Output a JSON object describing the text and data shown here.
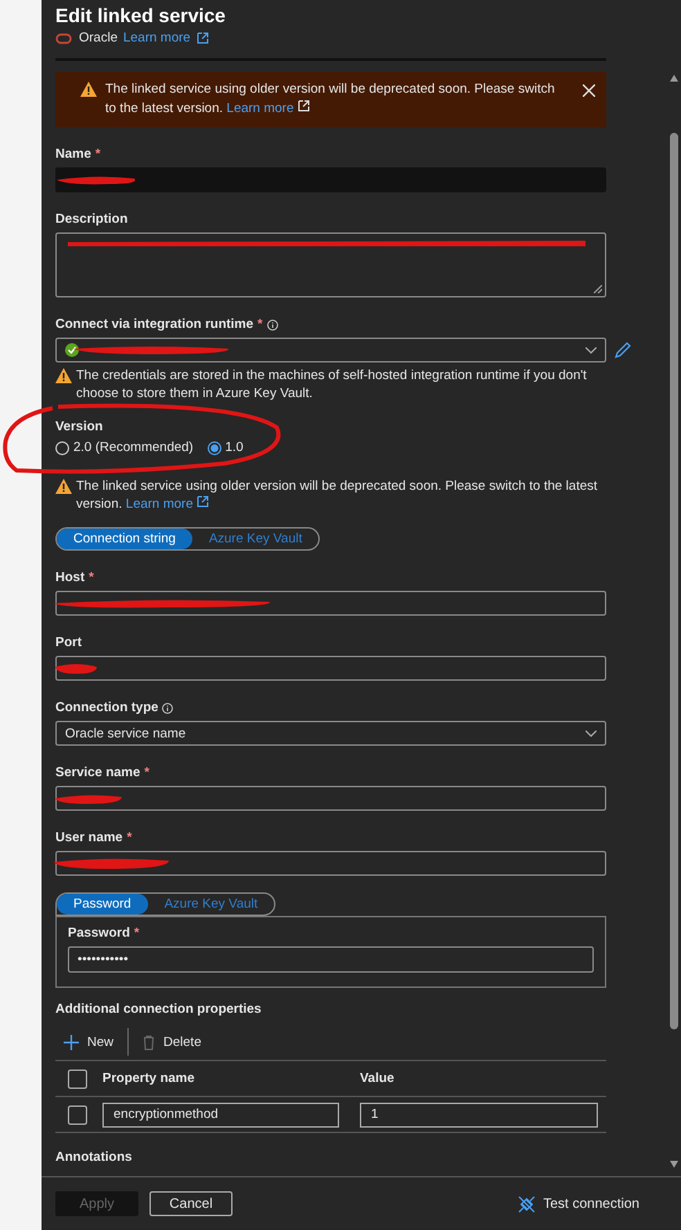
{
  "header": {
    "title": "Edit linked service",
    "service": "Oracle",
    "learn_more": "Learn more"
  },
  "banner": {
    "message": "The linked service using older version will be deprecated soon. Please switch to the latest version.",
    "link": "Learn more"
  },
  "name": {
    "label": "Name",
    "mark": "*"
  },
  "description": {
    "label": "Description"
  },
  "runtime": {
    "label": "Connect via integration runtime",
    "mark": "*",
    "warning": "The credentials are stored in the machines of self-hosted integration runtime if you don't choose to store them in Azure Key Vault."
  },
  "version": {
    "label": "Version",
    "options": [
      {
        "label": "2.0 (Recommended)",
        "selected": false
      },
      {
        "label": "1.0",
        "selected": true
      }
    ],
    "warning": "The linked service using older version will be deprecated soon. Please switch to the latest version.",
    "link": "Learn more"
  },
  "connection_tabs": [
    {
      "label": "Connection string",
      "selected": true
    },
    {
      "label": "Azure Key Vault",
      "selected": false
    }
  ],
  "host": {
    "label": "Host",
    "mark": "*"
  },
  "port": {
    "label": "Port"
  },
  "connection_type": {
    "label": "Connection type",
    "value": "Oracle service name"
  },
  "service_name": {
    "label": "Service name",
    "mark": "*"
  },
  "user_name": {
    "label": "User name",
    "mark": "*"
  },
  "password_tabs": [
    {
      "label": "Password",
      "selected": true
    },
    {
      "label": "Azure Key Vault",
      "selected": false
    }
  ],
  "password": {
    "label": "Password",
    "mark": "*",
    "value": "•••••••••••"
  },
  "additional": {
    "title": "Additional connection properties",
    "new": "New",
    "delete": "Delete",
    "columns": [
      "Property name",
      "Value"
    ],
    "rows": [
      {
        "checked": false,
        "property": "encryptionmethod",
        "value": "1"
      }
    ],
    "header_checked": false
  },
  "annotations": {
    "title": "Annotations"
  },
  "footer": {
    "apply": {
      "label": "Apply",
      "disabled": true
    },
    "cancel": "Cancel",
    "test": "Test connection"
  }
}
